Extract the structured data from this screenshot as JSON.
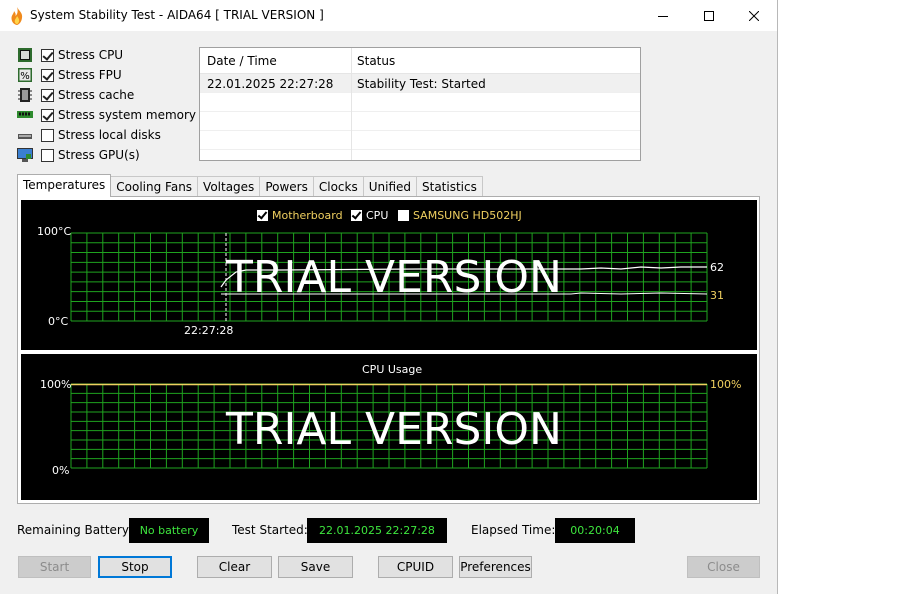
{
  "window": {
    "title": "System Stability Test - AIDA64  [ TRIAL VERSION ]"
  },
  "stress_options": [
    {
      "label": "Stress CPU",
      "checked": true,
      "icon": "cpu-chip-icon"
    },
    {
      "label": "Stress FPU",
      "checked": true,
      "icon": "fpu-percent-icon"
    },
    {
      "label": "Stress cache",
      "checked": true,
      "icon": "cache-icon"
    },
    {
      "label": "Stress system memory",
      "checked": true,
      "icon": "memory-module-icon"
    },
    {
      "label": "Stress local disks",
      "checked": false,
      "icon": "disk-drive-icon"
    },
    {
      "label": "Stress GPU(s)",
      "checked": false,
      "icon": "monitor-icon"
    }
  ],
  "log": {
    "columns": [
      "Date / Time",
      "Status"
    ],
    "rows": [
      {
        "datetime": "22.01.2025 22:27:28",
        "status": "Stability Test: Started"
      }
    ]
  },
  "tabs": [
    "Temperatures",
    "Cooling Fans",
    "Voltages",
    "Powers",
    "Clocks",
    "Unified",
    "Statistics"
  ],
  "active_tab": "Temperatures",
  "temperature_graph": {
    "legend": [
      {
        "label": "Motherboard",
        "checked": true,
        "color": "#f0d060"
      },
      {
        "label": "CPU",
        "checked": true,
        "color": "#ffffff"
      },
      {
        "label": "SAMSUNG HD502HJ",
        "checked": false,
        "color": "#f0d060"
      }
    ],
    "y_max_label": "100°C",
    "y_min_label": "0°C",
    "time_label": "22:27:28",
    "watermark": "TRIAL VERSION",
    "value_cpu": "62",
    "value_motherboard": "31",
    "grid_color": "#1fa31f"
  },
  "cpu_usage_graph": {
    "title": "CPU Usage",
    "y_max_label": "100%",
    "y_min_label": "0%",
    "watermark": "TRIAL VERSION",
    "current_value": "100%",
    "value_color": "#f0d060"
  },
  "status_bar": {
    "battery_label": "Remaining Battery:",
    "battery_value": "No battery",
    "started_label": "Test Started:",
    "started_value": "22.01.2025 22:27:28",
    "elapsed_label": "Elapsed Time:",
    "elapsed_value": "00:20:04"
  },
  "buttons": {
    "start": "Start",
    "stop": "Stop",
    "clear": "Clear",
    "save": "Save",
    "cpuid": "CPUID",
    "preferences": "Preferences",
    "close": "Close"
  }
}
